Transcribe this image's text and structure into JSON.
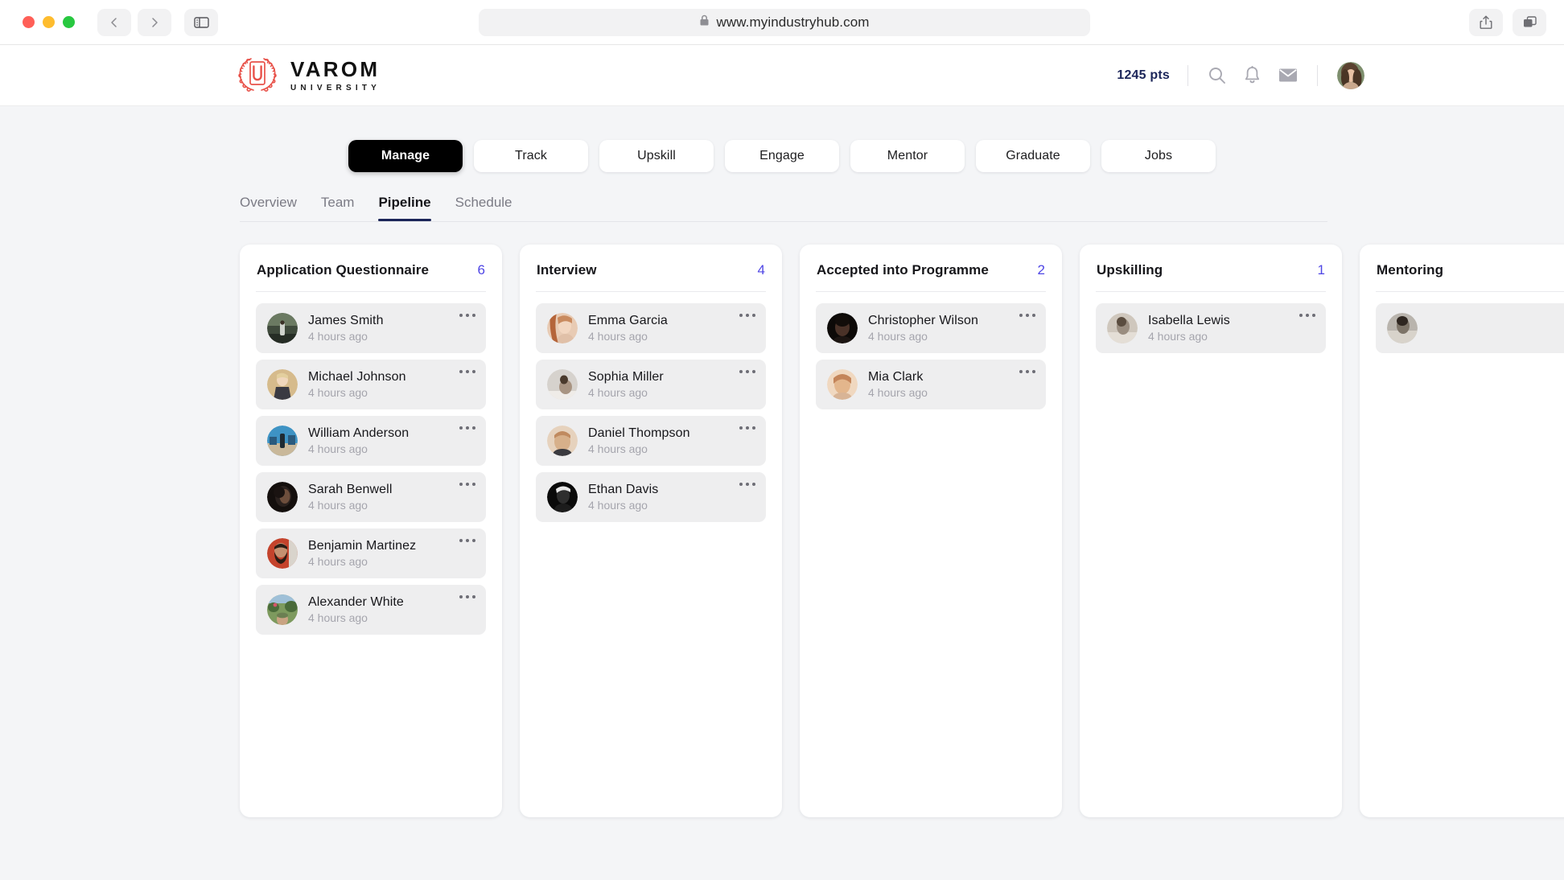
{
  "browser": {
    "url": "www.myindustryhub.com",
    "back_label": "Back",
    "forward_label": "Forward",
    "sidebar_label": "Show Sidebar",
    "share_label": "Share",
    "tabs_label": "Show Tab Overview",
    "lock_icon": "lock-icon"
  },
  "header": {
    "logo_name": "VAROM",
    "logo_sub": "UNIVERSITY",
    "points": "1245 pts",
    "icons": [
      "search-icon",
      "bell-icon",
      "mail-icon"
    ],
    "avatar_alt": "User avatar"
  },
  "nav": {
    "pills": [
      {
        "label": "Manage",
        "active": true
      },
      {
        "label": "Track",
        "active": false
      },
      {
        "label": "Upskill",
        "active": false
      },
      {
        "label": "Engage",
        "active": false
      },
      {
        "label": "Mentor",
        "active": false
      },
      {
        "label": "Graduate",
        "active": false
      },
      {
        "label": "Jobs",
        "active": false
      }
    ]
  },
  "subtabs": [
    {
      "label": "Overview",
      "active": false
    },
    {
      "label": "Team",
      "active": false
    },
    {
      "label": "Pipeline",
      "active": true
    },
    {
      "label": "Schedule",
      "active": false
    }
  ],
  "colors": {
    "accent_count": "#4f46e5",
    "active_tab_underline": "#1b2559",
    "active_pill_bg": "#000000",
    "page_bg": "#f4f5f7",
    "card_bg": "#eeeeef",
    "logo_red": "#e8524a"
  },
  "board": {
    "columns": [
      {
        "title": "Application Questionnaire",
        "count": "6",
        "cards": [
          {
            "name": "James Smith",
            "time": "4 hours ago",
            "av": [
              "#3f4a3c",
              "#6b7a62",
              "#262d25"
            ]
          },
          {
            "name": "Michael Johnson",
            "time": "4 hours ago",
            "av": [
              "#d6bb8c",
              "#3a3a42",
              "#9a8462"
            ]
          },
          {
            "name": "William Anderson",
            "time": "4 hours ago",
            "av": [
              "#3e93c4",
              "#c9b89a",
              "#2a5a7d"
            ]
          },
          {
            "name": "Sarah Benwell",
            "time": "4 hours ago",
            "av": [
              "#2a211e",
              "#6d4e3c",
              "#140f0d"
            ]
          },
          {
            "name": "Benjamin Martinez",
            "time": "4 hours ago",
            "av": [
              "#c4432c",
              "#3c2a20",
              "#d9d4cc"
            ]
          },
          {
            "name": "Alexander White",
            "time": "4 hours ago",
            "av": [
              "#7d9a5e",
              "#4a6b3a",
              "#b8c4a0"
            ]
          }
        ]
      },
      {
        "title": "Interview",
        "count": "4",
        "cards": [
          {
            "name": "Emma Garcia",
            "time": "4 hours ago",
            "av": [
              "#c98a5e",
              "#e8cbb4",
              "#8d5a3a"
            ]
          },
          {
            "name": "Sophia Miller",
            "time": "4 hours ago",
            "av": [
              "#d6d2cd",
              "#a89482",
              "#bdb5ac"
            ]
          },
          {
            "name": "Daniel Thompson",
            "time": "4 hours ago",
            "av": [
              "#d7b08a",
              "#c08a5f",
              "#e6d2bd"
            ]
          },
          {
            "name": "Ethan Davis",
            "time": "4 hours ago",
            "av": [
              "#141414",
              "#3a3a3a",
              "#0a0a0a"
            ]
          }
        ]
      },
      {
        "title": "Accepted into Programme",
        "count": "2",
        "cards": [
          {
            "name": "Christopher Wilson",
            "time": "4 hours ago",
            "av": [
              "#1c1512",
              "#4a3228",
              "#0d0a08"
            ]
          },
          {
            "name": "Mia Clark",
            "time": "4 hours ago",
            "av": [
              "#e3b68c",
              "#c4855a",
              "#f0d8c0"
            ]
          }
        ]
      },
      {
        "title": "Upskilling",
        "count": "1",
        "cards": [
          {
            "name": "Isabella Lewis",
            "time": "4 hours ago",
            "av": [
              "#cfc7bd",
              "#9a8d80",
              "#e4ded6"
            ]
          }
        ]
      },
      {
        "title": "Mentoring",
        "count": "",
        "cards": [
          {
            "name": "",
            "time": "",
            "av": [
              "#b9b4ad",
              "#7d7468",
              "#d8d3cb"
            ]
          }
        ]
      }
    ]
  }
}
